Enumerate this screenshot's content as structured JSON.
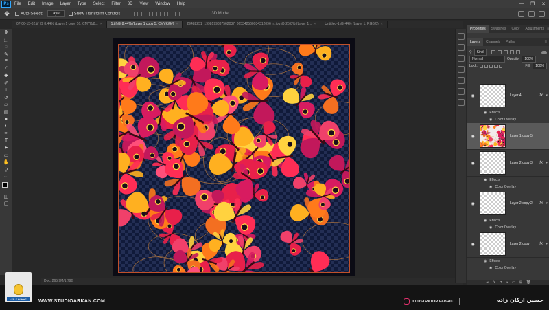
{
  "app": {
    "logo_text": "Ps"
  },
  "menu": [
    "File",
    "Edit",
    "Image",
    "Layer",
    "Type",
    "Select",
    "Filter",
    "3D",
    "View",
    "Window",
    "Help"
  ],
  "window_controls": [
    "—",
    "❐",
    "✕"
  ],
  "options_bar": {
    "auto_select_label": "Auto-Select:",
    "auto_select_value": "Layer",
    "transform_controls_label": "Show Transform Controls",
    "mode_3d_label": "3D Mode:"
  },
  "tabs": [
    {
      "label": "07-06-15-02.tif @ 8.44% (Layer 1 copy 16, CMYK/8...",
      "active": false
    },
    {
      "label": "1.tif @ 8.44% (Layer 1 copy 5, CMYK/8#)",
      "active": true
    },
    {
      "label": "29482251_1998199837562037_865342560934312096_n.jpg @ 25.8% (Layer 1...",
      "active": false
    },
    {
      "label": "Untitled-1 @ 44% (Layer 1, RGB/8)",
      "active": false
    }
  ],
  "status_bar": "Doc: 265.9M/1.79G",
  "panels": {
    "top_tabs": [
      "Properties",
      "Swatches",
      "Color",
      "Adjustments"
    ],
    "layer_tabs": [
      "Layers",
      "Channels",
      "Paths"
    ],
    "kind_label": "Kind",
    "blend_mode": "Normal",
    "opacity_label": "Opacity:",
    "opacity_value": "100%",
    "lock_label": "Lock:",
    "fill_label": "Fill:",
    "fill_value": "100%",
    "layers": [
      {
        "name": "Layer 4",
        "has_fx": true,
        "effects": "Effects",
        "effect_item": "Color Overlay",
        "selected": false,
        "thumb": "transparent"
      },
      {
        "name": "Layer 1 copy 5",
        "has_fx": false,
        "selected": true,
        "thumb": "art"
      },
      {
        "name": "Layer 2 copy 3",
        "has_fx": true,
        "effects": "Effects",
        "effect_item": "Color Overlay",
        "selected": false,
        "thumb": "transparent"
      },
      {
        "name": "Layer 2 copy 2",
        "has_fx": true,
        "effects": "Effects",
        "effect_item": "Color Overlay",
        "selected": false,
        "thumb": "transparent"
      },
      {
        "name": "Layer 2 copy",
        "has_fx": true,
        "effects": "Effects",
        "effect_item": "Color Overlay",
        "selected": false,
        "thumb": "transparent"
      }
    ]
  },
  "footer": {
    "logo_caption": "استودیو ارکان",
    "website": "WWW.STUDIOARKAN.COM",
    "instagram": "ILLUSTRATOR.FABRIC",
    "author": "حسین ارکان زاده"
  },
  "colors": {
    "accent_frame": "#c0502a",
    "pattern_bg": "#101a3a"
  }
}
